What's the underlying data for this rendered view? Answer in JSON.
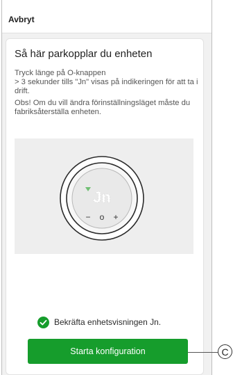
{
  "header": {
    "cancel_label": "Avbryt"
  },
  "card": {
    "title": "Så här parkopplar du enheten",
    "instruction_line1": "Tryck länge på O-knappen",
    "instruction_line2": "> 3 sekunder tills \"Jn\" visas på indikeringen för att ta i drift.",
    "note": "Obs! Om du vill ändra förinställningsläget måste du fabriksåterställa enheten."
  },
  "device": {
    "display_text": "Jn",
    "minus_symbol": "−",
    "o_symbol": "o",
    "plus_symbol": "+",
    "indicator_color": "#6fbf73"
  },
  "confirmation": {
    "text": "Bekräfta enhetsvisningen Jn.",
    "icon": "check-circle-icon"
  },
  "actions": {
    "start_label": "Starta konfiguration"
  },
  "callout": {
    "label": "C"
  },
  "colors": {
    "accent": "#169d2c",
    "background": "#f1f1f1"
  }
}
